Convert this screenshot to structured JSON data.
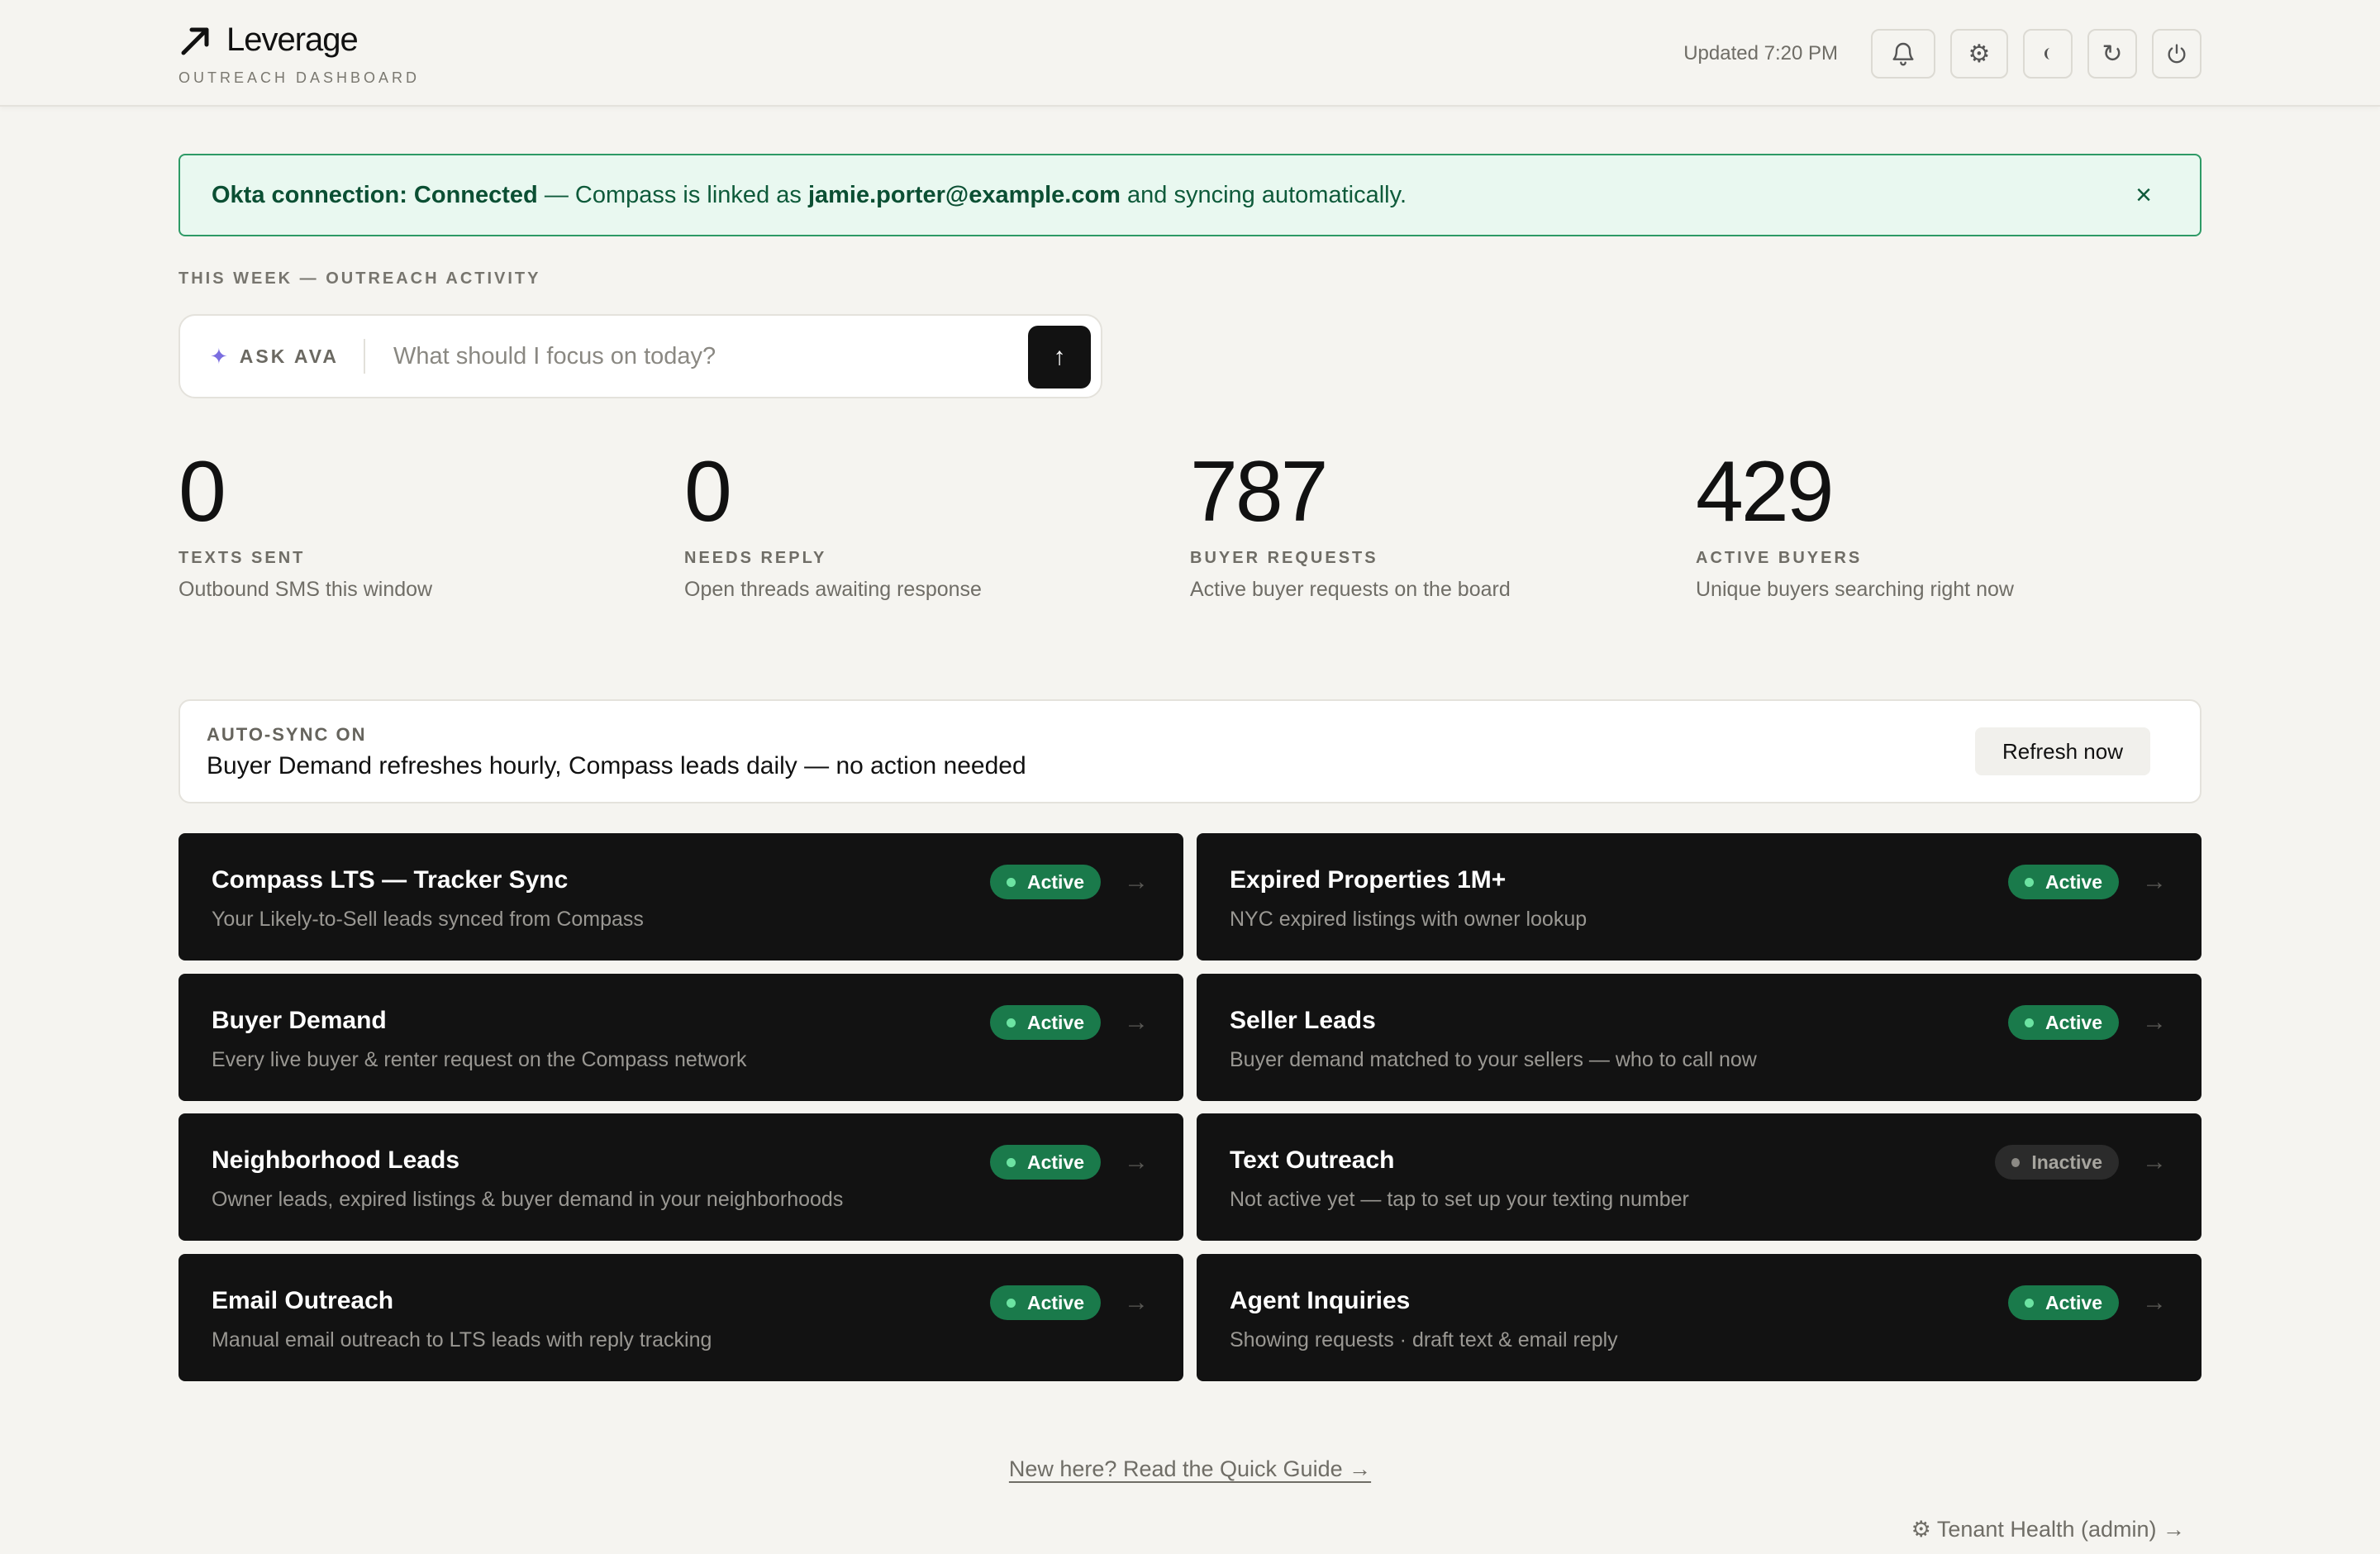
{
  "header": {
    "brand": "Leverage",
    "subtitle": "OUTREACH DASHBOARD",
    "updated": "Updated 7:20 PM",
    "buttons": {
      "notifications": "bell-icon",
      "settings": "gear-icon",
      "theme": "half-moon-icon",
      "refresh": "refresh-icon",
      "power": "power-icon"
    }
  },
  "banner": {
    "prefix": "Okta connection: Connected",
    "middle": " — Compass is linked as ",
    "email": "jamie.porter@example.com",
    "suffix": " and syncing automatically.",
    "close": "×"
  },
  "section_label": "THIS WEEK — OUTREACH ACTIVITY",
  "ask": {
    "label": "ASK AVA",
    "placeholder": "What should I focus on today?",
    "send": "↑"
  },
  "stats": [
    {
      "value": "0",
      "label": "TEXTS SENT",
      "desc": "Outbound SMS this window"
    },
    {
      "value": "0",
      "label": "NEEDS REPLY",
      "desc": "Open threads awaiting response"
    },
    {
      "value": "787",
      "label": "BUYER REQUESTS",
      "desc": "Active buyer requests on the board"
    },
    {
      "value": "429",
      "label": "ACTIVE BUYERS",
      "desc": "Unique buyers searching right now"
    }
  ],
  "autosync": {
    "title": "AUTO-SYNC ON",
    "text": "Buyer Demand refreshes hourly, Compass leads daily — no action needed",
    "button": "Refresh now"
  },
  "cards": [
    {
      "title": "Compass LTS — Tracker Sync",
      "desc": "Your Likely-to-Sell leads synced from Compass",
      "status": "Active"
    },
    {
      "title": "Expired Properties 1M+",
      "desc": "NYC expired listings with owner lookup",
      "status": "Active"
    },
    {
      "title": "Buyer Demand",
      "desc": "Every live buyer & renter request on the Compass network",
      "status": "Active"
    },
    {
      "title": "Seller Leads",
      "desc": "Buyer demand matched to your sellers — who to call now",
      "status": "Active"
    },
    {
      "title": "Neighborhood Leads",
      "desc": "Owner leads, expired listings & buyer demand in your neighborhoods",
      "status": "Active"
    },
    {
      "title": "Text Outreach",
      "desc": "Not active yet — tap to set up your texting number",
      "status": "Inactive"
    },
    {
      "title": "Email Outreach",
      "desc": "Manual email outreach to LTS leads with reply tracking",
      "status": "Active"
    },
    {
      "title": "Agent Inquiries",
      "desc": "Showing requests · draft text & email reply",
      "status": "Active"
    }
  ],
  "arrow": "→",
  "footer": {
    "guide": "New here? Read the Quick Guide →",
    "tenant": "⚙ Tenant Health (admin) →"
  },
  "colors": {
    "background": "#f5f4f0",
    "card": "#121212",
    "active_badge": "#1a7a4b",
    "banner_bg": "#e9f8f0",
    "banner_border": "#2e9a66"
  }
}
